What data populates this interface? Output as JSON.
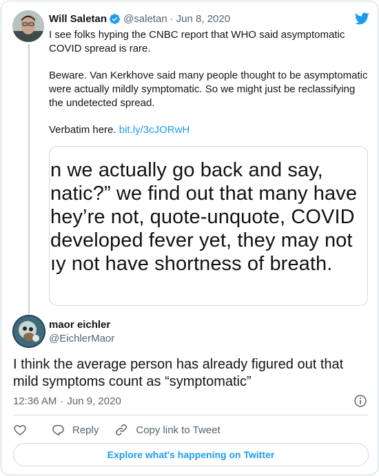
{
  "colors": {
    "accent": "#1d9bf0",
    "text": "#0f1419",
    "secondary": "#536471",
    "border": "#cfd9de"
  },
  "parent_tweet": {
    "author_name": "Will Saletan",
    "handle": "@saletan",
    "separator": "·",
    "date": "Jun 8, 2020",
    "verified_icon": "verified-badge-icon",
    "paragraphs": [
      "I see folks hyping the CNBC report that WHO said asymptomatic COVID spread is rare.",
      "Beware. Van Kerkhove said many people thought to be asymptomatic were actually mildly symptomatic. So we might just be reclassifying the undetected spread."
    ],
    "verbatim_prefix": "Verbatim here.",
    "link_text": "bit.ly/3cJORwH",
    "media_lines": [
      "n we actually go back and say,",
      "natic?” we find out that many have",
      "hey’re not, quote-unquote, COVID",
      "developed fever yet, they may not",
      "ıy not have shortness of breath."
    ]
  },
  "reply_tweet": {
    "author_name": "maor eichler",
    "handle": "@EichlerMaor",
    "text": "I think the average person has already figured out that mild symptoms count as “symptomatic”",
    "time": "12:36 AM",
    "separator": "·",
    "date": "Jun 9, 2020"
  },
  "actions": {
    "like_icon": "heart-icon",
    "reply_label": "Reply",
    "copy_label": "Copy link to Tweet"
  },
  "explore_label": "Explore what's happening on Twitter",
  "brand_icon": "twitter-bird-icon"
}
